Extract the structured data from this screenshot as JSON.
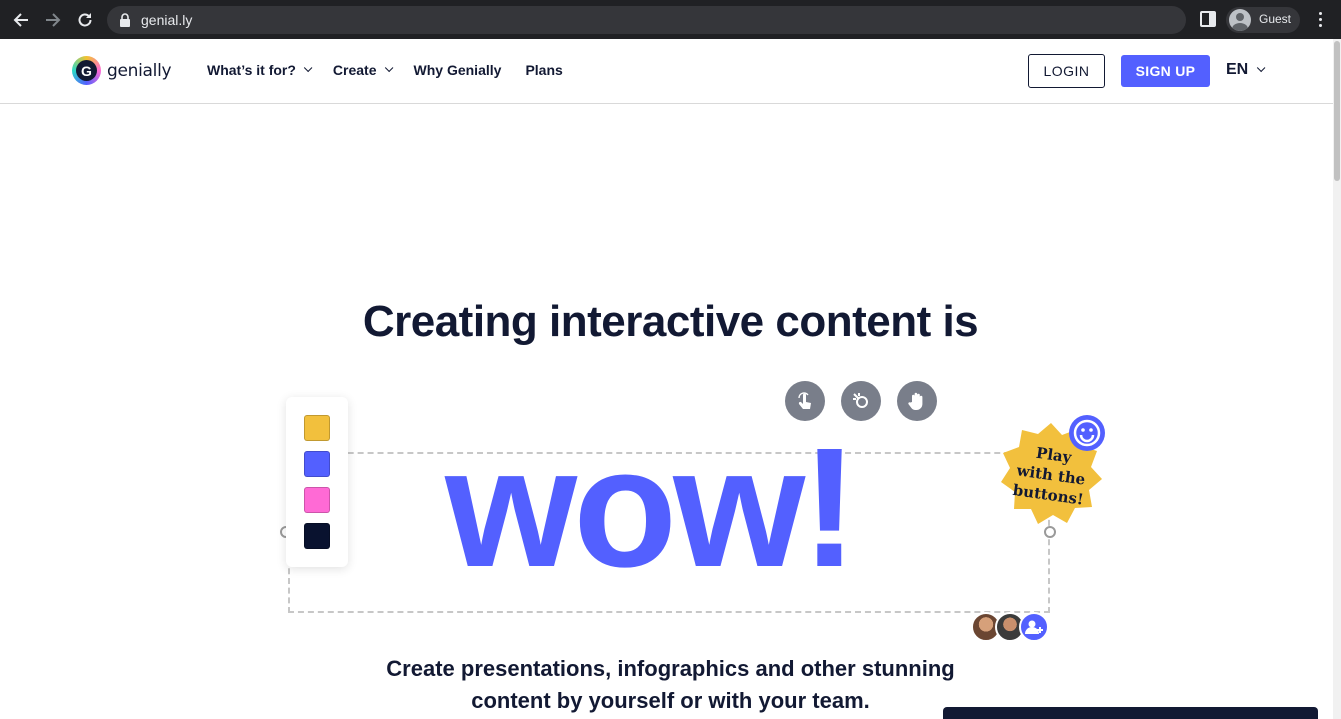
{
  "browser": {
    "url": "genial.ly",
    "profile_label": "Guest"
  },
  "header": {
    "logo_text": "genially",
    "nav": [
      {
        "label": "What’s it for?",
        "has_dropdown": true
      },
      {
        "label": "Create",
        "has_dropdown": true
      },
      {
        "label": "Why Genially",
        "has_dropdown": false
      },
      {
        "label": "Plans",
        "has_dropdown": false
      }
    ],
    "login_label": "LOGIN",
    "signup_label": "SIGN UP",
    "language": "EN"
  },
  "hero": {
    "title": "Creating interactive content is",
    "big_word": "wow!",
    "badge_lines": [
      "Play",
      "with the",
      "buttons!"
    ],
    "subtitle_line1": "Create presentations, infographics and other stunning",
    "subtitle_line2": "content by yourself or with your team."
  },
  "palette": {
    "colors": [
      "#f2c03d",
      "#5360ff",
      "#ff6ad5",
      "#09122f"
    ]
  },
  "colors": {
    "brand": "#5360ff",
    "text": "#121933",
    "badge": "#f2c03d",
    "tool_button": "#797e8a"
  },
  "tools": [
    "tap-icon",
    "magic-icon",
    "hand-icon"
  ]
}
